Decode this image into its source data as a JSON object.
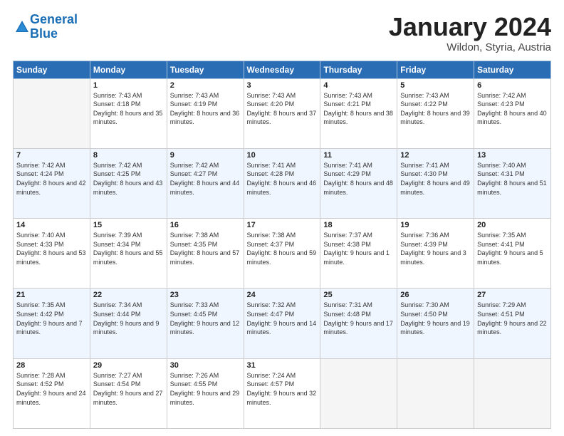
{
  "header": {
    "logo_line1": "General",
    "logo_line2": "Blue",
    "month": "January 2024",
    "location": "Wildon, Styria, Austria"
  },
  "days_of_week": [
    "Sunday",
    "Monday",
    "Tuesday",
    "Wednesday",
    "Thursday",
    "Friday",
    "Saturday"
  ],
  "weeks": [
    [
      {
        "day": "",
        "empty": true
      },
      {
        "day": "1",
        "sunrise": "7:43 AM",
        "sunset": "4:18 PM",
        "daylight": "8 hours and 35 minutes."
      },
      {
        "day": "2",
        "sunrise": "7:43 AM",
        "sunset": "4:19 PM",
        "daylight": "8 hours and 36 minutes."
      },
      {
        "day": "3",
        "sunrise": "7:43 AM",
        "sunset": "4:20 PM",
        "daylight": "8 hours and 37 minutes."
      },
      {
        "day": "4",
        "sunrise": "7:43 AM",
        "sunset": "4:21 PM",
        "daylight": "8 hours and 38 minutes."
      },
      {
        "day": "5",
        "sunrise": "7:43 AM",
        "sunset": "4:22 PM",
        "daylight": "8 hours and 39 minutes."
      },
      {
        "day": "6",
        "sunrise": "7:42 AM",
        "sunset": "4:23 PM",
        "daylight": "8 hours and 40 minutes."
      }
    ],
    [
      {
        "day": "7",
        "sunrise": "7:42 AM",
        "sunset": "4:24 PM",
        "daylight": "8 hours and 42 minutes."
      },
      {
        "day": "8",
        "sunrise": "7:42 AM",
        "sunset": "4:25 PM",
        "daylight": "8 hours and 43 minutes."
      },
      {
        "day": "9",
        "sunrise": "7:42 AM",
        "sunset": "4:27 PM",
        "daylight": "8 hours and 44 minutes."
      },
      {
        "day": "10",
        "sunrise": "7:41 AM",
        "sunset": "4:28 PM",
        "daylight": "8 hours and 46 minutes."
      },
      {
        "day": "11",
        "sunrise": "7:41 AM",
        "sunset": "4:29 PM",
        "daylight": "8 hours and 48 minutes."
      },
      {
        "day": "12",
        "sunrise": "7:41 AM",
        "sunset": "4:30 PM",
        "daylight": "8 hours and 49 minutes."
      },
      {
        "day": "13",
        "sunrise": "7:40 AM",
        "sunset": "4:31 PM",
        "daylight": "8 hours and 51 minutes."
      }
    ],
    [
      {
        "day": "14",
        "sunrise": "7:40 AM",
        "sunset": "4:33 PM",
        "daylight": "8 hours and 53 minutes."
      },
      {
        "day": "15",
        "sunrise": "7:39 AM",
        "sunset": "4:34 PM",
        "daylight": "8 hours and 55 minutes."
      },
      {
        "day": "16",
        "sunrise": "7:38 AM",
        "sunset": "4:35 PM",
        "daylight": "8 hours and 57 minutes."
      },
      {
        "day": "17",
        "sunrise": "7:38 AM",
        "sunset": "4:37 PM",
        "daylight": "8 hours and 59 minutes."
      },
      {
        "day": "18",
        "sunrise": "7:37 AM",
        "sunset": "4:38 PM",
        "daylight": "9 hours and 1 minute."
      },
      {
        "day": "19",
        "sunrise": "7:36 AM",
        "sunset": "4:39 PM",
        "daylight": "9 hours and 3 minutes."
      },
      {
        "day": "20",
        "sunrise": "7:35 AM",
        "sunset": "4:41 PM",
        "daylight": "9 hours and 5 minutes."
      }
    ],
    [
      {
        "day": "21",
        "sunrise": "7:35 AM",
        "sunset": "4:42 PM",
        "daylight": "9 hours and 7 minutes."
      },
      {
        "day": "22",
        "sunrise": "7:34 AM",
        "sunset": "4:44 PM",
        "daylight": "9 hours and 9 minutes."
      },
      {
        "day": "23",
        "sunrise": "7:33 AM",
        "sunset": "4:45 PM",
        "daylight": "9 hours and 12 minutes."
      },
      {
        "day": "24",
        "sunrise": "7:32 AM",
        "sunset": "4:47 PM",
        "daylight": "9 hours and 14 minutes."
      },
      {
        "day": "25",
        "sunrise": "7:31 AM",
        "sunset": "4:48 PM",
        "daylight": "9 hours and 17 minutes."
      },
      {
        "day": "26",
        "sunrise": "7:30 AM",
        "sunset": "4:50 PM",
        "daylight": "9 hours and 19 minutes."
      },
      {
        "day": "27",
        "sunrise": "7:29 AM",
        "sunset": "4:51 PM",
        "daylight": "9 hours and 22 minutes."
      }
    ],
    [
      {
        "day": "28",
        "sunrise": "7:28 AM",
        "sunset": "4:52 PM",
        "daylight": "9 hours and 24 minutes."
      },
      {
        "day": "29",
        "sunrise": "7:27 AM",
        "sunset": "4:54 PM",
        "daylight": "9 hours and 27 minutes."
      },
      {
        "day": "30",
        "sunrise": "7:26 AM",
        "sunset": "4:55 PM",
        "daylight": "9 hours and 29 minutes."
      },
      {
        "day": "31",
        "sunrise": "7:24 AM",
        "sunset": "4:57 PM",
        "daylight": "9 hours and 32 minutes."
      },
      {
        "day": "",
        "empty": true
      },
      {
        "day": "",
        "empty": true
      },
      {
        "day": "",
        "empty": true
      }
    ]
  ]
}
